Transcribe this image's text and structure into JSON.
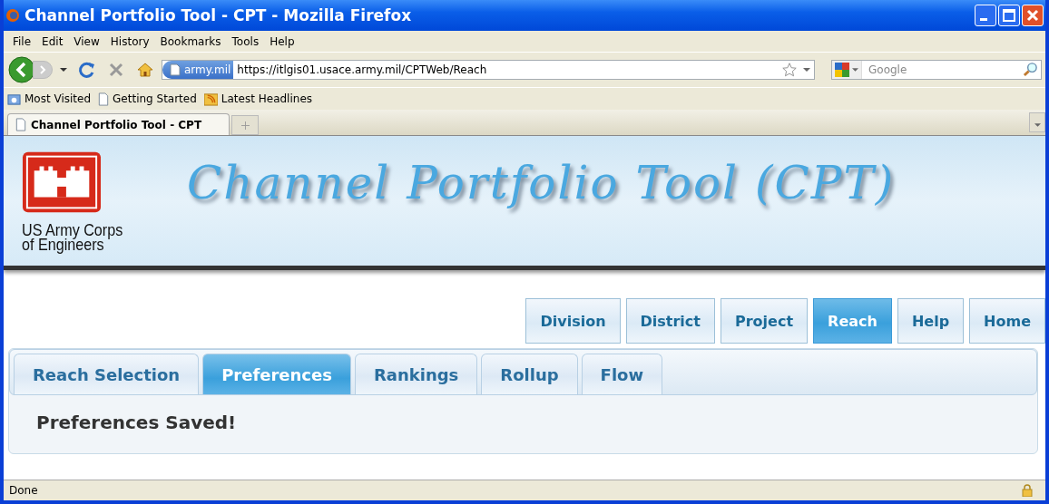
{
  "window": {
    "title": "Channel Portfolio Tool - CPT - Mozilla Firefox"
  },
  "menu": [
    "File",
    "Edit",
    "View",
    "History",
    "Bookmarks",
    "Tools",
    "Help"
  ],
  "address_bar": {
    "site_badge": "army.mil",
    "url": "https://itlgis01.usace.army.mil/CPTWeb/Reach"
  },
  "search": {
    "placeholder": "Google"
  },
  "bookmarks": [
    {
      "label": "Most Visited",
      "kind": "folder"
    },
    {
      "label": "Getting Started",
      "kind": "page"
    },
    {
      "label": "Latest Headlines",
      "kind": "feed"
    }
  ],
  "browser_tabs": [
    {
      "label": "Channel Portfolio Tool - CPT",
      "selected": true
    }
  ],
  "banner": {
    "logo_text": "US Army Corps\nof Engineers",
    "title": "Channel Portfolio Tool (CPT)"
  },
  "nav_buttons": [
    {
      "label": "Division",
      "selected": false
    },
    {
      "label": "District",
      "selected": false
    },
    {
      "label": "Project",
      "selected": false
    },
    {
      "label": "Reach",
      "selected": true
    },
    {
      "label": "Help",
      "selected": false
    },
    {
      "label": "Home",
      "selected": false
    }
  ],
  "sub_tabs": [
    {
      "label": "Reach Selection",
      "selected": false
    },
    {
      "label": "Preferences",
      "selected": true
    },
    {
      "label": "Rankings",
      "selected": false
    },
    {
      "label": "Rollup",
      "selected": false
    },
    {
      "label": "Flow",
      "selected": false
    }
  ],
  "message": "Preferences Saved!",
  "status_bar": {
    "text": "Done"
  }
}
